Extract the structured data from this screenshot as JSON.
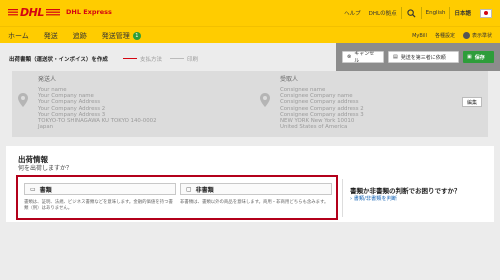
{
  "header": {
    "brand_name": "DHL Express",
    "help": "ヘルプ",
    "locations": "DHLの拠点",
    "lang_en": "English",
    "lang_jp": "日本語"
  },
  "nav": {
    "items": [
      {
        "label": "ホーム"
      },
      {
        "label": "発送"
      },
      {
        "label": "追跡"
      },
      {
        "label": "発送管理",
        "badge": "1"
      }
    ],
    "mybill": "MyBill",
    "settings": "各種設定",
    "user": "表示準状"
  },
  "steps": {
    "step1": "出荷書類（運送状・インボイス）を作成",
    "step2": "支払方法",
    "step3": "印刷"
  },
  "actions": {
    "cancel": "キャンセル",
    "send_third": "発送を第三者に依頼",
    "save": "保存"
  },
  "shipper": {
    "label": "発送人",
    "lines": [
      "Your name",
      "Your Company name",
      "Your Company Address",
      "Your Company Address 2",
      "Your Company Address 3",
      "TOKYO-TO SHINAGAWA KU TOKYO 140-0002",
      "Japan"
    ]
  },
  "receiver": {
    "label": "受取人",
    "lines": [
      "Consignee name",
      "Consignee Company name",
      "Consignee Company address",
      "Consignee Company address 2",
      "Consignee Company address 3",
      "NEW YORK New York 10010",
      "United States of America"
    ],
    "edit": "編集"
  },
  "shipment_info": {
    "title": "出荷情報",
    "question": "何を出荷しますか？",
    "doc_label": "書類",
    "doc_desc": "書類は、証明、法規、ビジネス書類などを意味します。金融的価値を持つ書類（例）はありません。",
    "nondoc_label": "非書類",
    "nondoc_desc": "非書類は、書類以外の商品を意味します。商用・非商用どちらも含みます。"
  },
  "help_panel": {
    "title": "書類か非書類の判断でお困りですか？",
    "link": "書類/非書類を判断"
  },
  "colors": {
    "dhl_yellow": "#ffcc00",
    "dhl_red": "#d40511",
    "save_green": "#2e9d3a",
    "highlight_border": "#b3001b"
  }
}
